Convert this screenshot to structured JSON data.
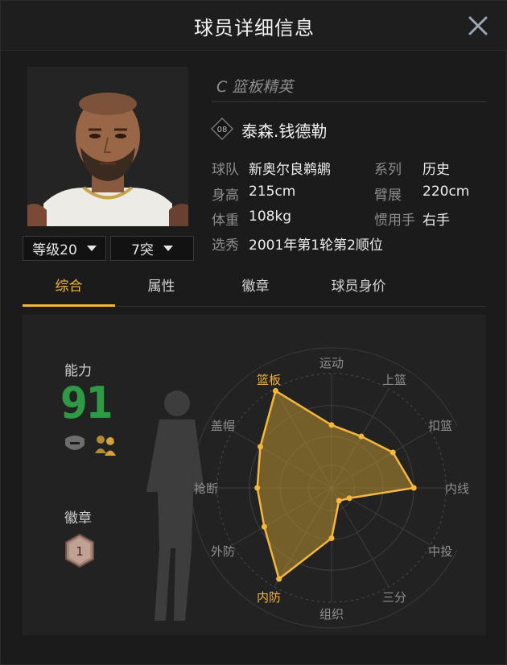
{
  "header": {
    "title": "球员详细信息"
  },
  "player": {
    "position_label": "C 篮板精英",
    "jersey_icon_text": "08",
    "name": "泰森.钱德勒"
  },
  "info": {
    "team_label": "球队",
    "team_value": "新奥尔良鹈鹕",
    "series_label": "系列",
    "series_value": "历史",
    "height_label": "身高",
    "height_value": "215cm",
    "wingspan_label": "臂展",
    "wingspan_value": "220cm",
    "weight_label": "体重",
    "weight_value": "108kg",
    "hand_label": "惯用手",
    "hand_value": "右手",
    "draft_label": "选秀",
    "draft_value": "2001年第1轮第2顺位"
  },
  "controls": {
    "level_label": "等级20",
    "breakthrough_label": "7突"
  },
  "tabs": [
    {
      "label": "综合"
    },
    {
      "label": "属性"
    },
    {
      "label": "徽章"
    },
    {
      "label": "球员身价"
    }
  ],
  "summary": {
    "ability_label": "能力",
    "ability_value": "91",
    "badge_label": "徽章",
    "badge_count": "1"
  },
  "radar": {
    "labels": [
      "运动",
      "上篮",
      "扣篮",
      "内线",
      "中投",
      "三分",
      "组织",
      "内防",
      "外防",
      "抢断",
      "盖帽",
      "篮板"
    ],
    "highlighted": [
      "篮板",
      "内防"
    ],
    "values": [
      0.55,
      0.52,
      0.62,
      0.72,
      0.18,
      0.13,
      0.44,
      0.92,
      0.68,
      0.65,
      0.72,
      0.98
    ],
    "fill_color": "#b8902f",
    "stroke_color": "#f4b73c",
    "accent_color": "#f4b73c"
  },
  "colors": {
    "ability_green": "#2f9a44",
    "accent": "#f4b73c"
  }
}
